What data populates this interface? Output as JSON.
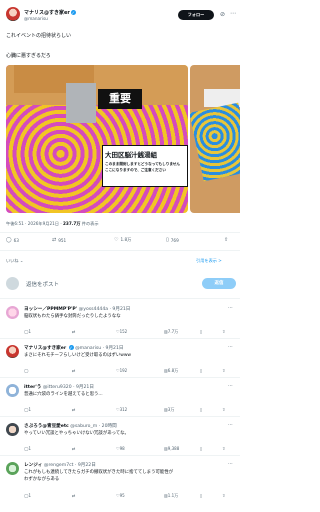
{
  "post": {
    "author_name": "マナリス@すき家er",
    "author_handle": "@manarisu",
    "follow_label": "フォロー",
    "text_line1": "これイベントの招待状らしい",
    "text_line2": "心臓に悪すぎるだろ",
    "photo_sign": "重要",
    "photo_label_title": "大田区脳汁銭湯組",
    "photo_label_line1": "このまま開封しますとどうなってもしりません",
    "photo_label_line2": "ここになりますので、ご注意ください",
    "timestamp": "午後6:51 · 2026年9月21日 ·",
    "views": "237.7万",
    "views_suffix": "件の表示",
    "replies": "63",
    "reposts": "951",
    "likes": "1.8万",
    "bookmarks": "769",
    "relevance": "いいね ⌄",
    "translate": "引用を表示 >"
  },
  "reply_box": {
    "placeholder": "返信をポスト",
    "button": "返信"
  },
  "replies": [
    {
      "name": "ヨッシー／PPMMP'P'P'",
      "handle": "@yoss4444a · 9月21日",
      "text": "脳収状もわたら鍋手な封筒だったりしたようなな",
      "reply_count": "1",
      "repost_count": "",
      "like_count": "152",
      "view_count": "7.7万"
    },
    {
      "name": "マナリス@すき家er",
      "handle": "@manarisu · 9月21日",
      "text": "まさにそれモチーフらしいけど受け取るのはずいwww",
      "reply_count": "",
      "repost_count": "",
      "like_count": "192",
      "view_count": "6.8万"
    },
    {
      "name": "itter'う",
      "handle": "@itteru9320 · 9月21日",
      "text": "普通に穴袋のラインを越えてると思う...",
      "reply_count": "1",
      "repost_count": "",
      "like_count": "312",
      "view_count": "3万"
    },
    {
      "name": "さぶろう@青豆愛etc",
      "handle": "@saburo_m · 20時間",
      "text": "やっていい冗談とやっちゃいけない冗談があってな。",
      "reply_count": "1",
      "repost_count": "",
      "like_count": "98",
      "view_count": "9,388"
    },
    {
      "name": "レンジィ",
      "handle": "@rengem7ct · 9月22日",
      "text_line1": "これがもしも連続してきたらガチの撤収状がきた時に捨ててしまう可能性が",
      "text_line2": "わずかながらある",
      "reply_count": "1",
      "repost_count": "",
      "like_count": "95",
      "view_count": "1.1万"
    }
  ],
  "icons": {
    "verified": "verified-badge-icon",
    "grok": "grok-icon",
    "more": "more-icon",
    "reply": "reply-icon",
    "repost": "repost-icon",
    "like": "like-icon",
    "views": "views-icon",
    "bookmark": "bookmark-icon",
    "share": "share-icon"
  },
  "colors": {
    "accent": "#1d9bf0",
    "text": "#0f1419",
    "muted": "#536471"
  }
}
